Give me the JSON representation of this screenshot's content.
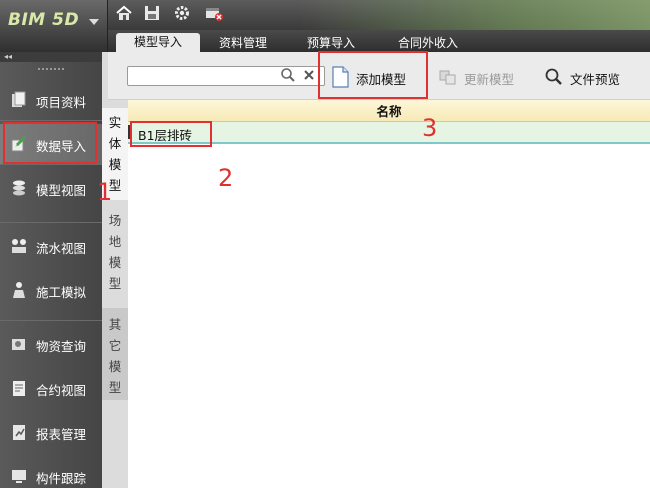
{
  "app": {
    "logo": "BIM 5D"
  },
  "quick_access": [
    {
      "icon": "home-icon"
    },
    {
      "icon": "save-icon"
    },
    {
      "icon": "gear-icon"
    },
    {
      "icon": "close-project-icon"
    }
  ],
  "tabs": [
    {
      "label": "模型导入",
      "active": true
    },
    {
      "label": "资料管理",
      "active": false
    },
    {
      "label": "预算导入",
      "active": false
    },
    {
      "label": "合同外收入",
      "active": false
    }
  ],
  "nav": {
    "collapse_label": "◂◂",
    "items": [
      {
        "label": "项目资料",
        "icon": "project-docs-icon"
      },
      {
        "label": "数据导入",
        "icon": "data-import-icon",
        "active": true
      },
      {
        "label": "模型视图",
        "icon": "model-view-icon"
      },
      {
        "label": "流水视图",
        "icon": "flow-view-icon"
      },
      {
        "label": "施工模拟",
        "icon": "construction-sim-icon"
      },
      {
        "label": "物资查询",
        "icon": "material-query-icon"
      },
      {
        "label": "合约视图",
        "icon": "contract-view-icon"
      },
      {
        "label": "报表管理",
        "icon": "report-icon"
      },
      {
        "label": "构件跟踪",
        "icon": "component-track-icon"
      }
    ]
  },
  "vertical_tabs": [
    {
      "label": "实体模型",
      "chars": [
        "实",
        "体",
        "模",
        "型"
      ],
      "active": true
    },
    {
      "label": "场地模型",
      "chars": [
        "场",
        "地",
        "模",
        "型"
      ]
    },
    {
      "label": "其它模型",
      "chars": [
        "其",
        "它",
        "模",
        "型"
      ]
    }
  ],
  "toolbar": {
    "search": {
      "value": "",
      "placeholder": ""
    },
    "add_model": "添加模型",
    "update_model": "更新模型",
    "file_preview": "文件预览"
  },
  "grid": {
    "columns": [
      "名称"
    ],
    "rows": [
      {
        "name": "B1层排砖"
      }
    ]
  },
  "annotations": {
    "marker_1": "1",
    "marker_2": "2",
    "marker_3": "3",
    "color": "#e03030"
  }
}
